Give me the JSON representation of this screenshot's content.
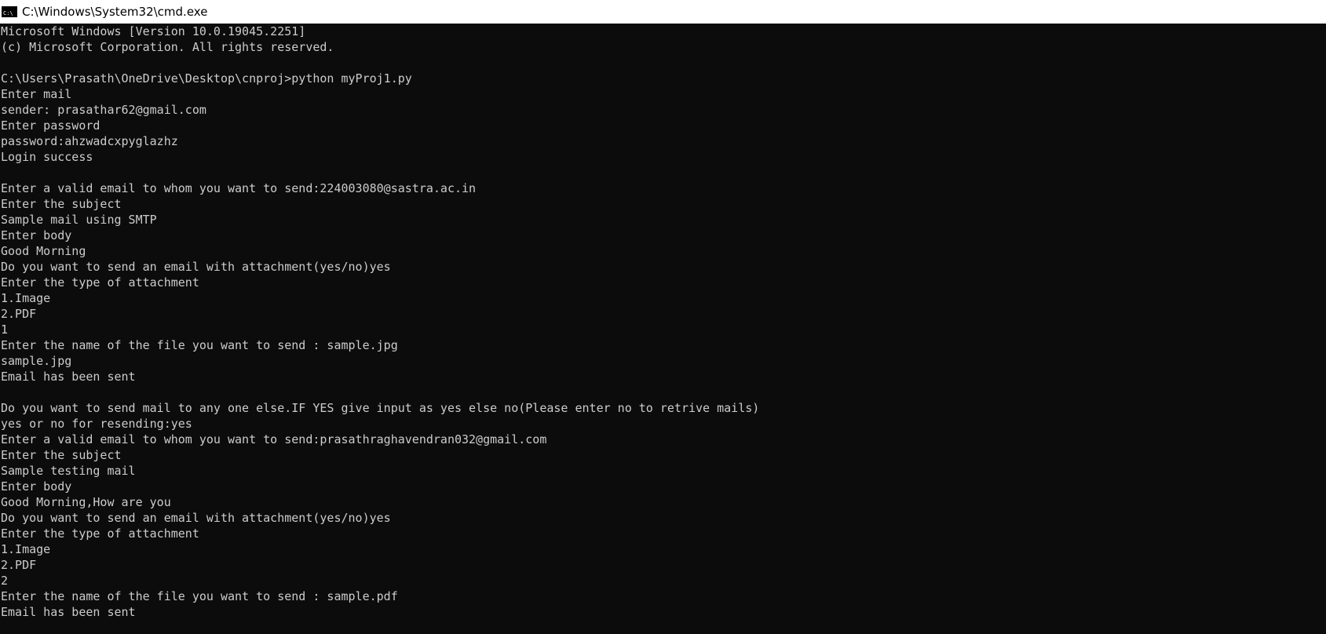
{
  "window": {
    "title": "C:\\Windows\\System32\\cmd.exe",
    "icon": "cmd-icon"
  },
  "colors": {
    "background": "#0c0c0c",
    "text": "#cccccc",
    "titlebar": "#ffffff"
  },
  "console": {
    "lines": [
      "Microsoft Windows [Version 10.0.19045.2251]",
      "(c) Microsoft Corporation. All rights reserved.",
      "",
      "C:\\Users\\Prasath\\OneDrive\\Desktop\\cnproj>python myProj1.py",
      "Enter mail",
      "sender: prasathar62@gmail.com",
      "Enter password",
      "password:ahzwadcxpyglazhz",
      "Login success",
      "",
      "Enter a valid email to whom you want to send:224003080@sastra.ac.in",
      "Enter the subject",
      "Sample mail using SMTP",
      "Enter body",
      "Good Morning",
      "Do you want to send an email with attachment(yes/no)yes",
      "Enter the type of attachment",
      "1.Image",
      "2.PDF",
      "1",
      "Enter the name of the file you want to send : sample.jpg",
      "sample.jpg",
      "Email has been sent",
      "",
      "Do you want to send mail to any one else.IF YES give input as yes else no(Please enter no to retrive mails)",
      "yes or no for resending:yes",
      "Enter a valid email to whom you want to send:prasathraghavendran032@gmail.com",
      "Enter the subject",
      "Sample testing mail",
      "Enter body",
      "Good Morning,How are you",
      "Do you want to send an email with attachment(yes/no)yes",
      "Enter the type of attachment",
      "1.Image",
      "2.PDF",
      "2",
      "Enter the name of the file you want to send : sample.pdf",
      "Email has been sent"
    ]
  }
}
